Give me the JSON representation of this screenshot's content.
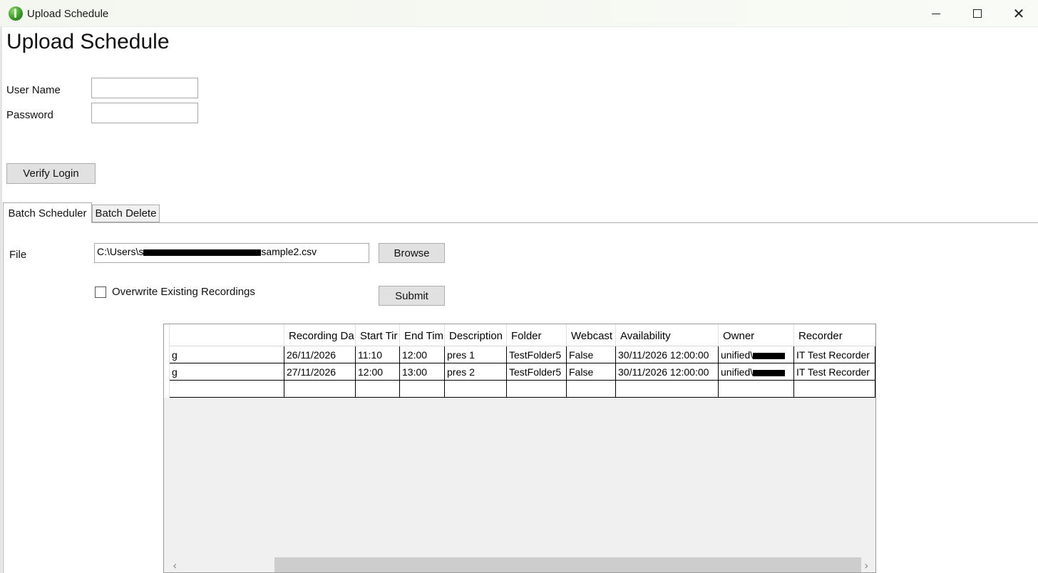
{
  "window": {
    "title": "Upload Schedule"
  },
  "page": {
    "title": "Upload Schedule"
  },
  "login": {
    "username_label": "User Name",
    "username_value": "",
    "password_label": "Password",
    "password_value": "",
    "verify_button": "Verify Login"
  },
  "tabs": [
    {
      "label": "Batch Scheduler",
      "active": true
    },
    {
      "label": "Batch Delete",
      "active": false
    }
  ],
  "batch": {
    "file_label": "File",
    "file_path_prefix": "C:\\Users\\s",
    "file_path_suffix": "sample2.csv",
    "browse_button": "Browse",
    "overwrite_label": "Overwrite Existing Recordings",
    "overwrite_checked": false,
    "submit_button": "Submit"
  },
  "grid": {
    "columns": [
      "",
      "Recording Da",
      "Start Tir",
      "End Tim",
      "Description",
      "Folder",
      "Webcast",
      "Availability",
      "Owner",
      "Recorder"
    ],
    "rows": [
      [
        "g",
        "26/11/2026",
        "11:10",
        "12:00",
        "pres 1",
        "TestFolder5",
        "False",
        "30/11/2026 12:00:00",
        "unified\\",
        "IT Test Recorder"
      ],
      [
        "g",
        "27/11/2026",
        "12:00",
        "13:00",
        "pres 2",
        "TestFolder5",
        "False",
        "30/11/2026 12:00:00",
        "unified\\",
        "IT Test Recorder"
      ],
      [
        "",
        "",
        "",
        "",
        "",
        "",
        "",
        "",
        "",
        ""
      ]
    ]
  },
  "icons": {
    "app": "app-globe-icon",
    "minimize": "minimize-icon",
    "maximize": "maximize-icon",
    "close": "close-icon",
    "scroll_left": "chevron-left-icon",
    "scroll_right": "chevron-right-icon"
  }
}
